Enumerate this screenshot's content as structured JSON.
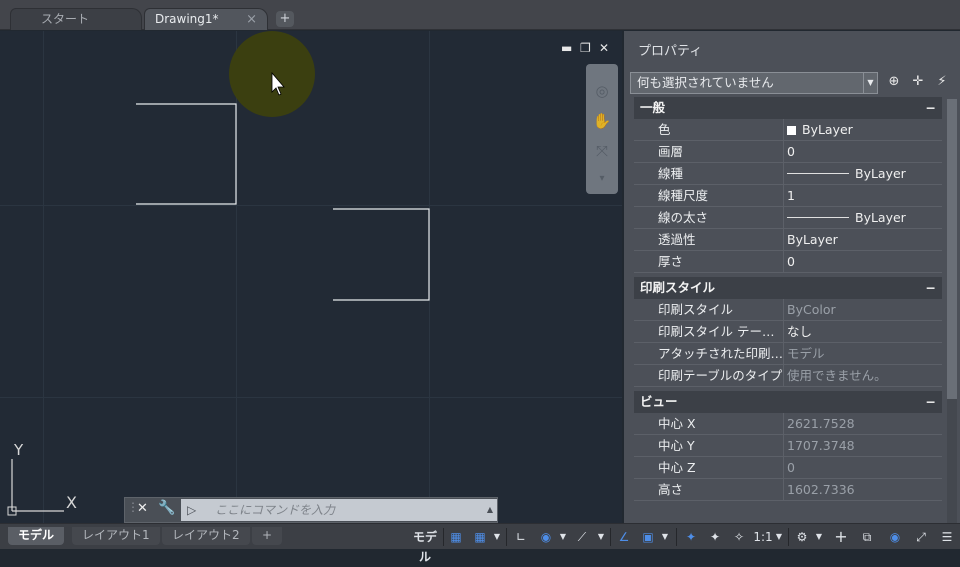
{
  "tabs": {
    "start": "スタート",
    "drawing": "Drawing1*",
    "close_glyph": "×",
    "add_glyph": "+"
  },
  "viewport": {
    "minimize": "▬",
    "restore": "❐",
    "close": "✕"
  },
  "commandline": {
    "placeholder": "ここにコマンドを入力",
    "prompt_icon": "▷"
  },
  "ucs": {
    "x": "X",
    "y": "Y"
  },
  "properties": {
    "title": "プロパティ",
    "selection": "何も選択されていません",
    "sections": [
      {
        "name": "一般",
        "rows": [
          {
            "key": "色",
            "value": "ByLayer"
          },
          {
            "key": "画層",
            "value": "0"
          },
          {
            "key": "線種",
            "value": "ByLayer"
          },
          {
            "key": "線種尺度",
            "value": "1"
          },
          {
            "key": "線の太さ",
            "value": "ByLayer"
          },
          {
            "key": "透過性",
            "value": "ByLayer"
          },
          {
            "key": "厚さ",
            "value": "0"
          }
        ]
      },
      {
        "name": "印刷スタイル",
        "rows": [
          {
            "key": "印刷スタイル",
            "value": "ByColor"
          },
          {
            "key": "印刷スタイル テー…",
            "value": "なし"
          },
          {
            "key": "アタッチされた印刷…",
            "value": "モデル"
          },
          {
            "key": "印刷テーブルのタイプ",
            "value": "使用できません。"
          }
        ]
      },
      {
        "name": "ビュー",
        "rows": [
          {
            "key": "中心 X",
            "value": "2621.7528"
          },
          {
            "key": "中心 Y",
            "value": "1707.3748"
          },
          {
            "key": "中心 Z",
            "value": "0"
          },
          {
            "key": "高さ",
            "value": "1602.7336"
          }
        ]
      }
    ],
    "collapse": "−"
  },
  "status": {
    "model_tab": "モデル",
    "layout1": "レイアウト1",
    "layout2": "レイアウト2",
    "add": "+",
    "model_btn": "モデル",
    "scale": "1:1"
  },
  "colors": {
    "canvas": "#222a35",
    "panel": "#4c5058",
    "accent": "#2a6fd6"
  }
}
